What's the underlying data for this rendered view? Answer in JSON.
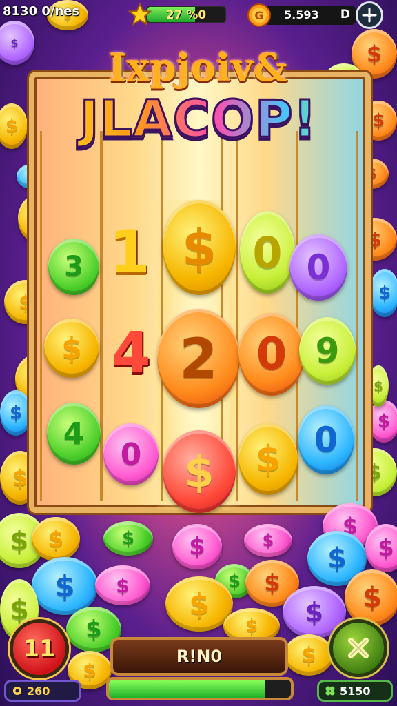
{
  "hud": {
    "left_counter": "8130 0/nes",
    "xp_text": "27 %0",
    "xp_progress": 0.62,
    "balance": "5.593",
    "balance_suffix": "D",
    "star_icon": "star-icon",
    "coin_icon": "coin-icon",
    "settings_icon": "refresh-icon"
  },
  "title": {
    "line1": "Ixpjoiv&",
    "line2": "JLACOP!"
  },
  "reels": {
    "symbols": [
      [
        "3",
        "$",
        "4"
      ],
      [
        "1",
        "4",
        "0"
      ],
      [
        "$",
        "2",
        "$"
      ],
      [
        "0",
        "0",
        "$"
      ],
      [
        "0",
        "9",
        "0"
      ]
    ]
  },
  "controls": {
    "spins_left": "11",
    "bet_value": "260",
    "mode_label": "R!N0",
    "progress": 0.86,
    "win_value": "5150",
    "cancel_icon": "close-icon"
  },
  "colors": {
    "gold": "#f6b600",
    "frame": "#e8b463",
    "background": "#5a1f8e"
  }
}
